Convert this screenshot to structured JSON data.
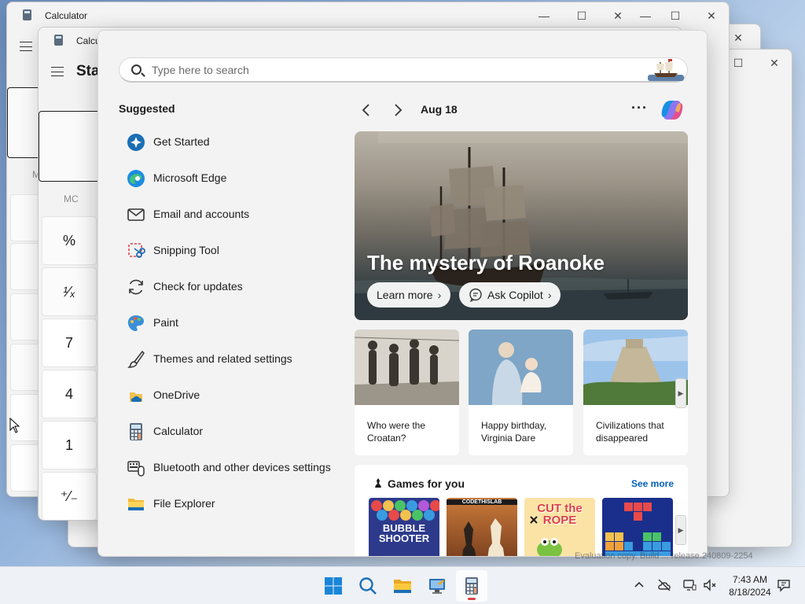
{
  "background_windows": {
    "window_title": "Calculator",
    "window_title_short": "Calcu",
    "mode_partial": "Sta",
    "memory_partial": "M",
    "memory_clear": "MC",
    "keys": [
      "%",
      "¹⁄ₓ",
      "7",
      "4",
      "1",
      "⁺⁄₋"
    ]
  },
  "search": {
    "placeholder": "Type here to search"
  },
  "suggested": {
    "title": "Suggested",
    "items": [
      {
        "label": "Get Started",
        "icon": "get-started-icon"
      },
      {
        "label": "Microsoft Edge",
        "icon": "edge-icon"
      },
      {
        "label": "Email and accounts",
        "icon": "mail-icon"
      },
      {
        "label": "Snipping Tool",
        "icon": "snipping-tool-icon"
      },
      {
        "label": "Check for updates",
        "icon": "refresh-icon"
      },
      {
        "label": "Paint",
        "icon": "paint-icon"
      },
      {
        "label": "Themes and related settings",
        "icon": "brush-icon"
      },
      {
        "label": "OneDrive",
        "icon": "onedrive-icon"
      },
      {
        "label": "Calculator",
        "icon": "calculator-icon"
      },
      {
        "label": "Bluetooth and other devices settings",
        "icon": "devices-icon"
      },
      {
        "label": "File Explorer",
        "icon": "folder-icon"
      }
    ]
  },
  "feed": {
    "date": "Aug 18",
    "hero": {
      "headline": "The mystery of Roanoke",
      "learn_more": "Learn more",
      "ask_copilot": "Ask Copilot"
    },
    "cards": [
      {
        "caption": "Who were the Croatan?"
      },
      {
        "caption": "Happy birthday, Virginia Dare"
      },
      {
        "caption": "Civilizations that disappeared"
      }
    ],
    "games": {
      "title": "Games for you",
      "see_more": "See more",
      "tiles": [
        {
          "label": "BUBBLE SHOOTER"
        },
        {
          "label": "CODETHISLAB"
        },
        {
          "label": "CUT the ROPE"
        },
        {
          "label": ""
        }
      ]
    }
  },
  "taskbar": {
    "time": "7:43 AM",
    "date": "8/18/2024"
  },
  "watermark": "Evaluation copy. Build ... release.240809-2254",
  "colors": {
    "accent": "#005fb8",
    "taskbar_active_indicator": "#d9434a"
  }
}
